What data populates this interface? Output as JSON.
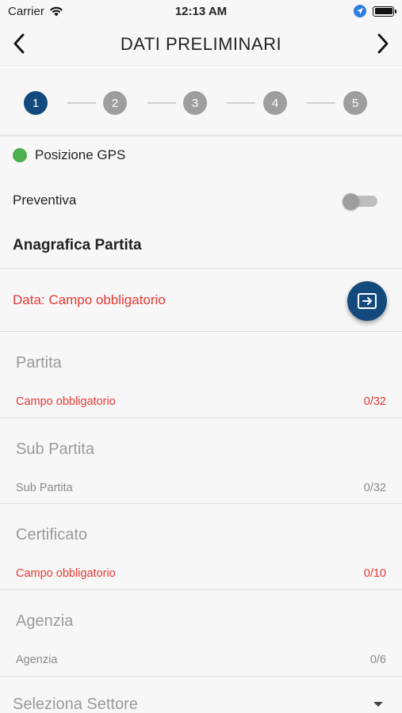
{
  "status_bar": {
    "carrier": "Carrier",
    "time": "12:13 AM",
    "icons": [
      "wifi-icon",
      "location-icon",
      "battery-icon"
    ]
  },
  "nav": {
    "title": "DATI PRELIMINARI",
    "back_icon": "chevron-left-icon",
    "next_icon": "chevron-right-icon"
  },
  "stepper": {
    "steps": [
      "1",
      "2",
      "3",
      "4",
      "5"
    ],
    "active_step": 1,
    "active_color": "#124a7e",
    "inactive_color": "#9e9e9e"
  },
  "gps": {
    "label": "Posizione GPS",
    "status_color": "#4caf50"
  },
  "preventiva": {
    "label": "Preventiva",
    "toggle_on": false
  },
  "anagrafica": {
    "title": "Anagrafica Partita",
    "date_error": "Data: Campo obbligatorio",
    "fab_icon": "enter-icon"
  },
  "fields": [
    {
      "label": "Partita",
      "helper": "Campo obbligatorio",
      "count": "0/32",
      "error": true
    },
    {
      "label": "Sub Partita",
      "helper": "Sub Partita",
      "count": "0/32",
      "error": false
    },
    {
      "label": "Certificato",
      "helper": "Campo obbligatorio",
      "count": "0/10",
      "error": true
    },
    {
      "label": "Agenzia",
      "helper": "Agenzia",
      "count": "0/6",
      "error": false
    }
  ],
  "settore": {
    "placeholder": "Seleziona Settore",
    "caret_icon": "caret-down-icon"
  },
  "colors": {
    "error": "#e53935",
    "primary": "#124a7e"
  }
}
